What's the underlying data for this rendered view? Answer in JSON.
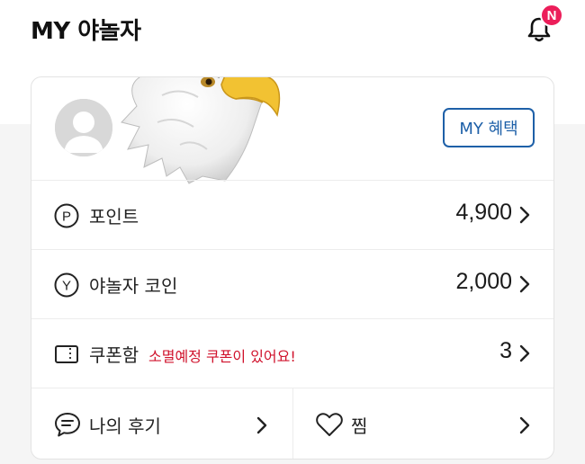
{
  "header": {
    "title": "MY 야놀자",
    "notification_badge": "N",
    "bell_icon": "bell-icon"
  },
  "profile": {
    "avatar_icon": "default-avatar-icon",
    "benefit_button": "MY 혜택",
    "image": "bald-eagle-head"
  },
  "rows": [
    {
      "icon": "point-circle-icon",
      "icon_letter": "P",
      "label": "포인트",
      "value": "4,900"
    },
    {
      "icon": "yanolja-coin-icon",
      "icon_letter": "Y",
      "label": "야놀자 코인",
      "value": "2,000"
    },
    {
      "icon": "coupon-icon",
      "label": "쿠폰함",
      "notice": "소멸예정 쿠폰이 있어요!",
      "value": "3"
    }
  ],
  "bottom": {
    "reviews_label": "나의 후기",
    "reviews_icon": "chat-bubble-icon",
    "wishlist_label": "찜",
    "wishlist_icon": "heart-icon"
  },
  "colors": {
    "accent_blue": "#1e60a8",
    "badge_pink": "#ec1e5a",
    "notice_red": "#d0112b"
  }
}
